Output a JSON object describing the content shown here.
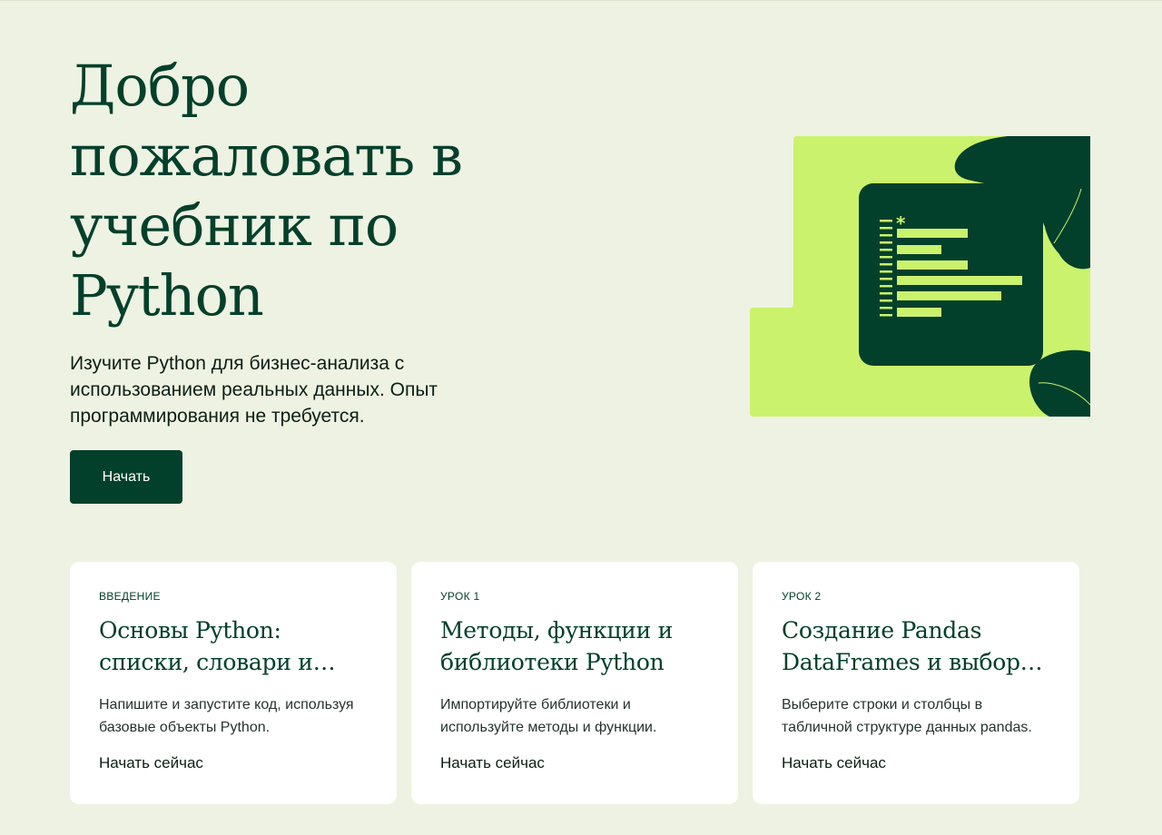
{
  "hero": {
    "title": "Добро пожаловать в учебник по Python",
    "subtitle": "Изучите Python для бизнес-анализа с использованием реальных данных. Опыт программирования не требуется.",
    "cta_label": "Начать"
  },
  "illustration": {
    "icon": "code-editor-illustration",
    "bullet_symbol": "*",
    "colors": {
      "background": "#CBF26C",
      "panel": "#03402B",
      "accent": "#CBF26C"
    }
  },
  "cards": [
    {
      "kicker": "ВВЕДЕНИЕ",
      "title": "Основы Python: списки, словари и функции",
      "description": "Напишите и запустите код, используя базовые объекты Python.",
      "link_label": "Начать сейчас"
    },
    {
      "kicker": "УРОК 1",
      "title": "Методы, функции и библиотеки Python",
      "description": "Импортируйте библиотеки и используйте методы и функции.",
      "link_label": "Начать сейчас"
    },
    {
      "kicker": "УРОК 2",
      "title": "Создание Pandas DataFrames и выборка данных",
      "description": "Выберите строки и столбцы в табличной структуре данных pandas.",
      "link_label": "Начать сейчас"
    }
  ],
  "theme": {
    "background": "#EEF2E2",
    "primary": "#03402B",
    "card_background": "#FFFFFF"
  }
}
